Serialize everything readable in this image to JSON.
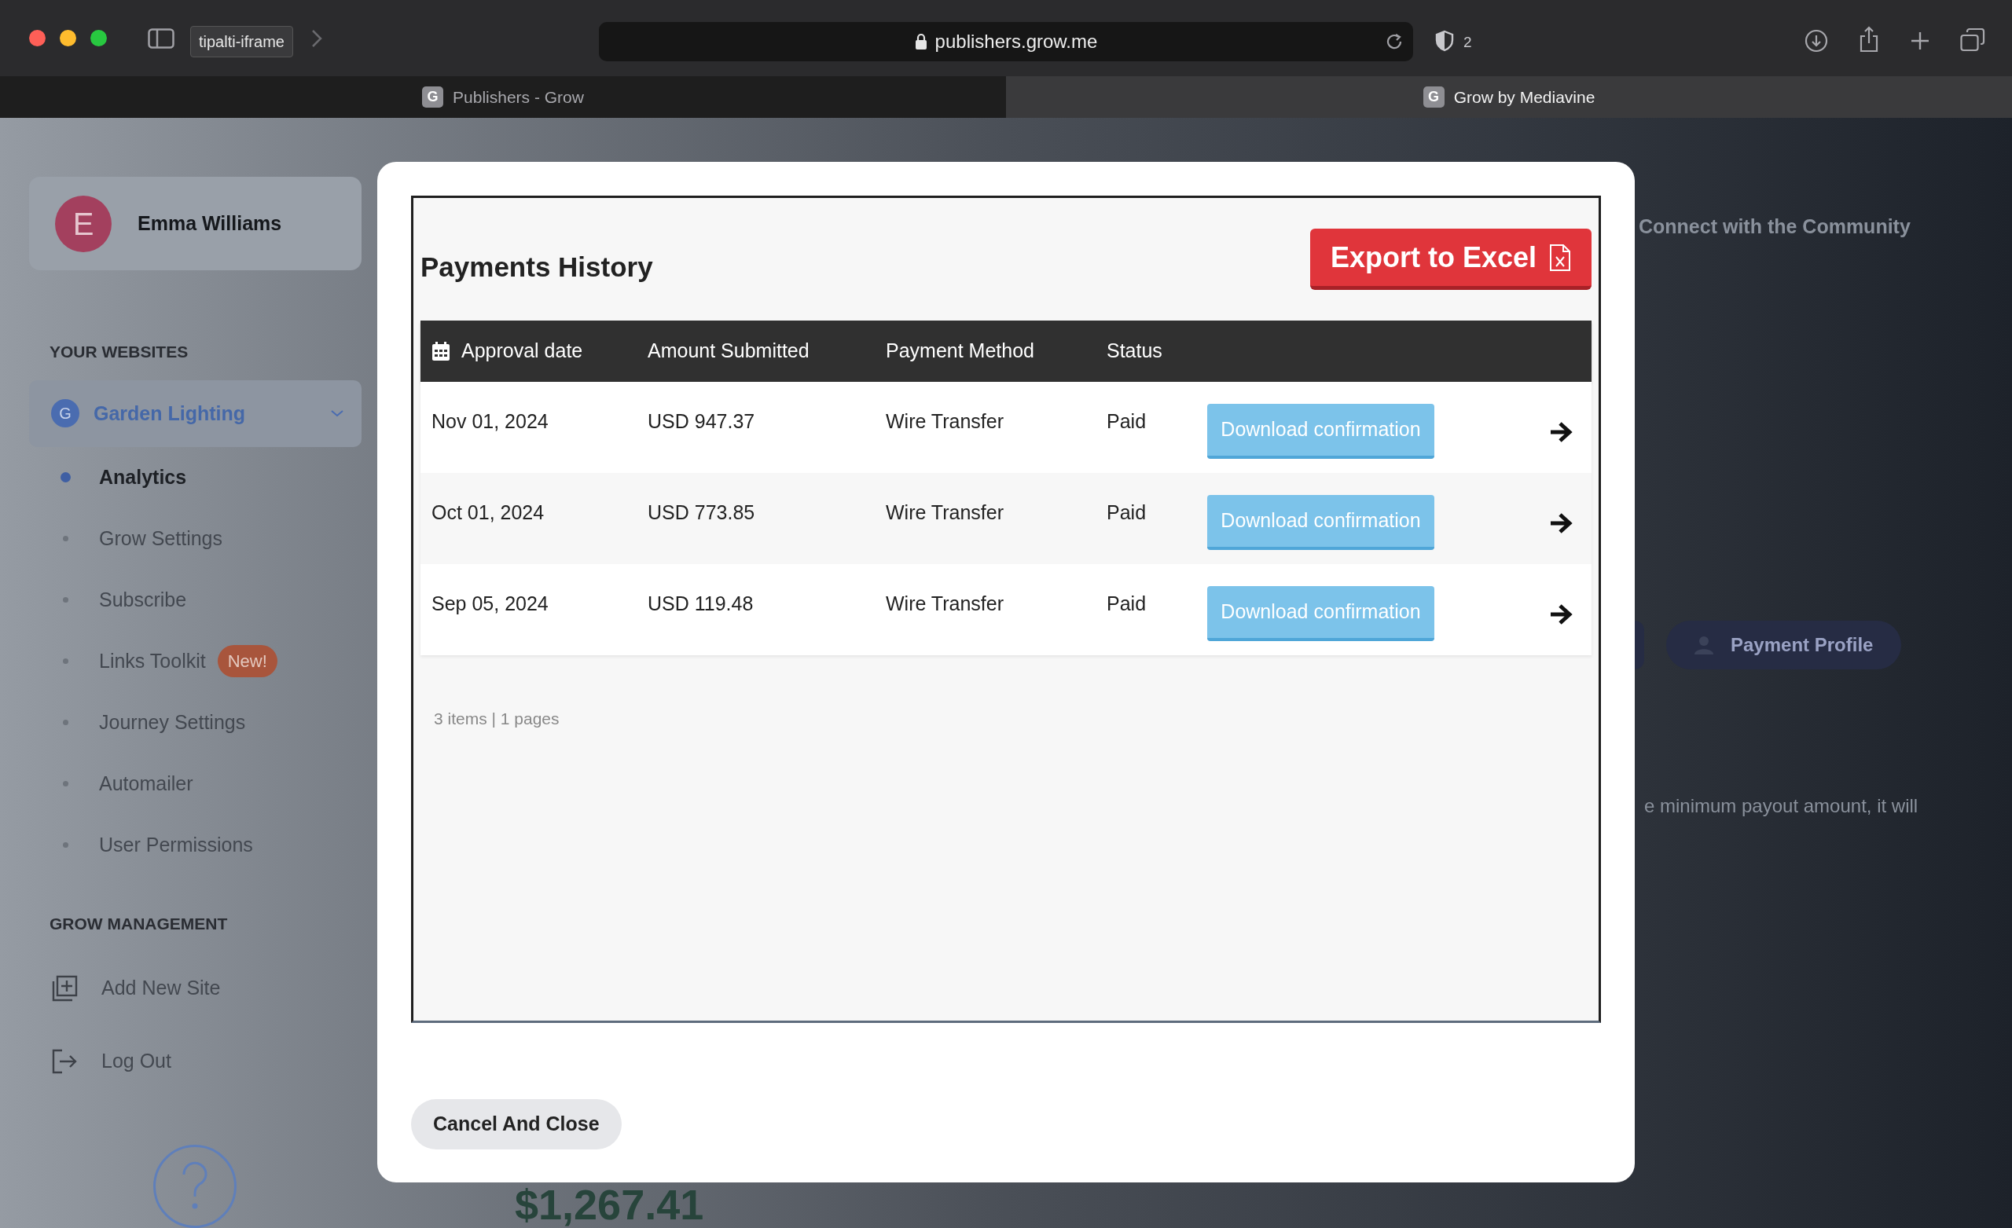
{
  "browser": {
    "tooltip": "tipalti-iframe",
    "url": "publishers.grow.me",
    "shield_count": "2",
    "tabs": [
      {
        "favicon": "G",
        "label": "Publishers - Grow",
        "selected": false
      },
      {
        "favicon": "G",
        "label": "Grow by Mediavine",
        "selected": true
      }
    ]
  },
  "sidebar": {
    "user": {
      "initial": "E",
      "name": "Emma Williams"
    },
    "websites_heading": "YOUR WEBSITES",
    "site": {
      "initial": "G",
      "name": "Garden Lighting",
      "expanded": true
    },
    "nav": [
      {
        "label": "Analytics",
        "selected": true
      },
      {
        "label": "Grow Settings",
        "selected": false
      },
      {
        "label": "Subscribe",
        "selected": false
      },
      {
        "label": "Links Toolkit",
        "selected": false,
        "badge": "New!"
      },
      {
        "label": "Journey Settings",
        "selected": false
      },
      {
        "label": "Automailer",
        "selected": false
      },
      {
        "label": "User Permissions",
        "selected": false
      }
    ],
    "management_heading": "GROW MANAGEMENT",
    "management": [
      {
        "kind": "add",
        "label": "Add New Site"
      },
      {
        "kind": "logout",
        "label": "Log Out"
      }
    ]
  },
  "background": {
    "community_heading": "Connect with the Community",
    "payment_profile_button": "Payment Profile",
    "payout_note": "e minimum payout amount, it will",
    "balance": "$1,267.41"
  },
  "modal": {
    "title": "Payments History",
    "export_button": "Export to Excel",
    "table": {
      "columns": [
        "Approval date",
        "Amount Submitted",
        "Payment Method",
        "Status"
      ],
      "rows": [
        {
          "date": "Nov 01, 2024",
          "amount": "USD 947.37",
          "method": "Wire Transfer",
          "status": "Paid",
          "action": "Download confirmation"
        },
        {
          "date": "Oct 01, 2024",
          "amount": "USD 773.85",
          "method": "Wire Transfer",
          "status": "Paid",
          "action": "Download confirmation"
        },
        {
          "date": "Sep 05, 2024",
          "amount": "USD 119.48",
          "method": "Wire Transfer",
          "status": "Paid",
          "action": "Download confirmation"
        }
      ]
    },
    "pagination": "3 items | 1 pages",
    "cancel_button": "Cancel And Close"
  }
}
